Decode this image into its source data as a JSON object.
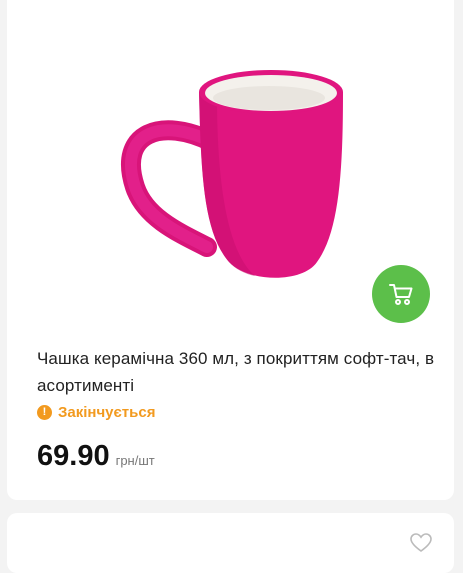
{
  "product": {
    "title": "Чашка керамічна 360 мл, з покриттям софт-тач, в асортименті",
    "status": "Закінчується",
    "status_icon": "!",
    "price": "69.90",
    "unit": "грн/шт",
    "image_icon": "mug-image",
    "cart_icon": "cart-icon"
  },
  "colors": {
    "accent_green": "#5cbf4a",
    "status_orange": "#f29a1f",
    "mug_pink": "#e0157f"
  },
  "next_card": {
    "favorite_icon": "heart-icon"
  }
}
